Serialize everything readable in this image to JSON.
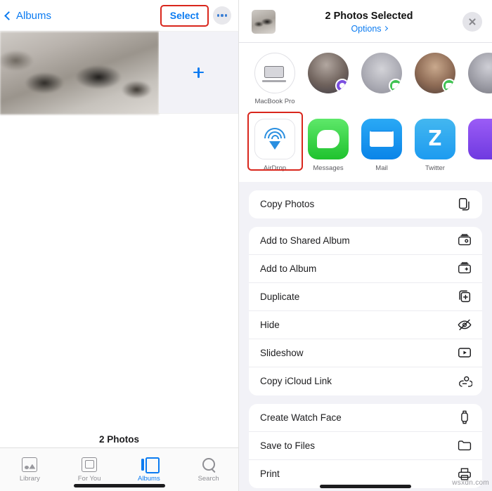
{
  "left": {
    "nav": {
      "back_label": "Albums",
      "select_label": "Select",
      "more_icon": "ellipsis-icon"
    },
    "grid": {
      "add_icon": "plus-icon"
    },
    "footer_count": "2 Photos",
    "tabs": [
      {
        "label": "Library",
        "icon": "library-icon",
        "active": false
      },
      {
        "label": "For You",
        "icon": "for-you-icon",
        "active": false
      },
      {
        "label": "Albums",
        "icon": "albums-icon",
        "active": true
      },
      {
        "label": "Search",
        "icon": "search-icon",
        "active": false
      }
    ]
  },
  "share_sheet": {
    "title": "2 Photos Selected",
    "options_label": "Options",
    "close_icon": "close-icon",
    "people": [
      {
        "label": "MacBook Pro",
        "kind": "device"
      },
      {
        "label": "",
        "kind": "contact-1"
      },
      {
        "label": "",
        "kind": "contact-2"
      },
      {
        "label": "",
        "kind": "contact-3"
      },
      {
        "label": "",
        "kind": "contact-4"
      }
    ],
    "apps": [
      {
        "label": "AirDrop",
        "icon": "airdrop-icon",
        "highlighted": true
      },
      {
        "label": "Messages",
        "icon": "messages-icon",
        "highlighted": false
      },
      {
        "label": "Mail",
        "icon": "mail-icon",
        "highlighted": false
      },
      {
        "label": "Twitter",
        "icon": "twitter-icon",
        "highlighted": false
      },
      {
        "label": "",
        "icon": "more-apps-icon",
        "highlighted": false
      }
    ],
    "actions_group_1": [
      {
        "label": "Copy Photos",
        "icon": "copy-icon"
      }
    ],
    "actions_group_2": [
      {
        "label": "Add to Shared Album",
        "icon": "shared-album-icon"
      },
      {
        "label": "Add to Album",
        "icon": "album-icon"
      },
      {
        "label": "Duplicate",
        "icon": "duplicate-icon"
      },
      {
        "label": "Hide",
        "icon": "eye-slash-icon"
      },
      {
        "label": "Slideshow",
        "icon": "play-rect-icon"
      },
      {
        "label": "Copy iCloud Link",
        "icon": "link-icon"
      }
    ],
    "actions_group_3": [
      {
        "label": "Create Watch Face",
        "icon": "watch-icon"
      },
      {
        "label": "Save to Files",
        "icon": "folder-icon"
      },
      {
        "label": "Print",
        "icon": "printer-icon"
      }
    ]
  },
  "watermark": "wsxdn.com",
  "colors": {
    "accent_blue": "#0b7bf1",
    "highlight_red": "#d9261c",
    "sheet_bg": "#f2f2f7"
  }
}
